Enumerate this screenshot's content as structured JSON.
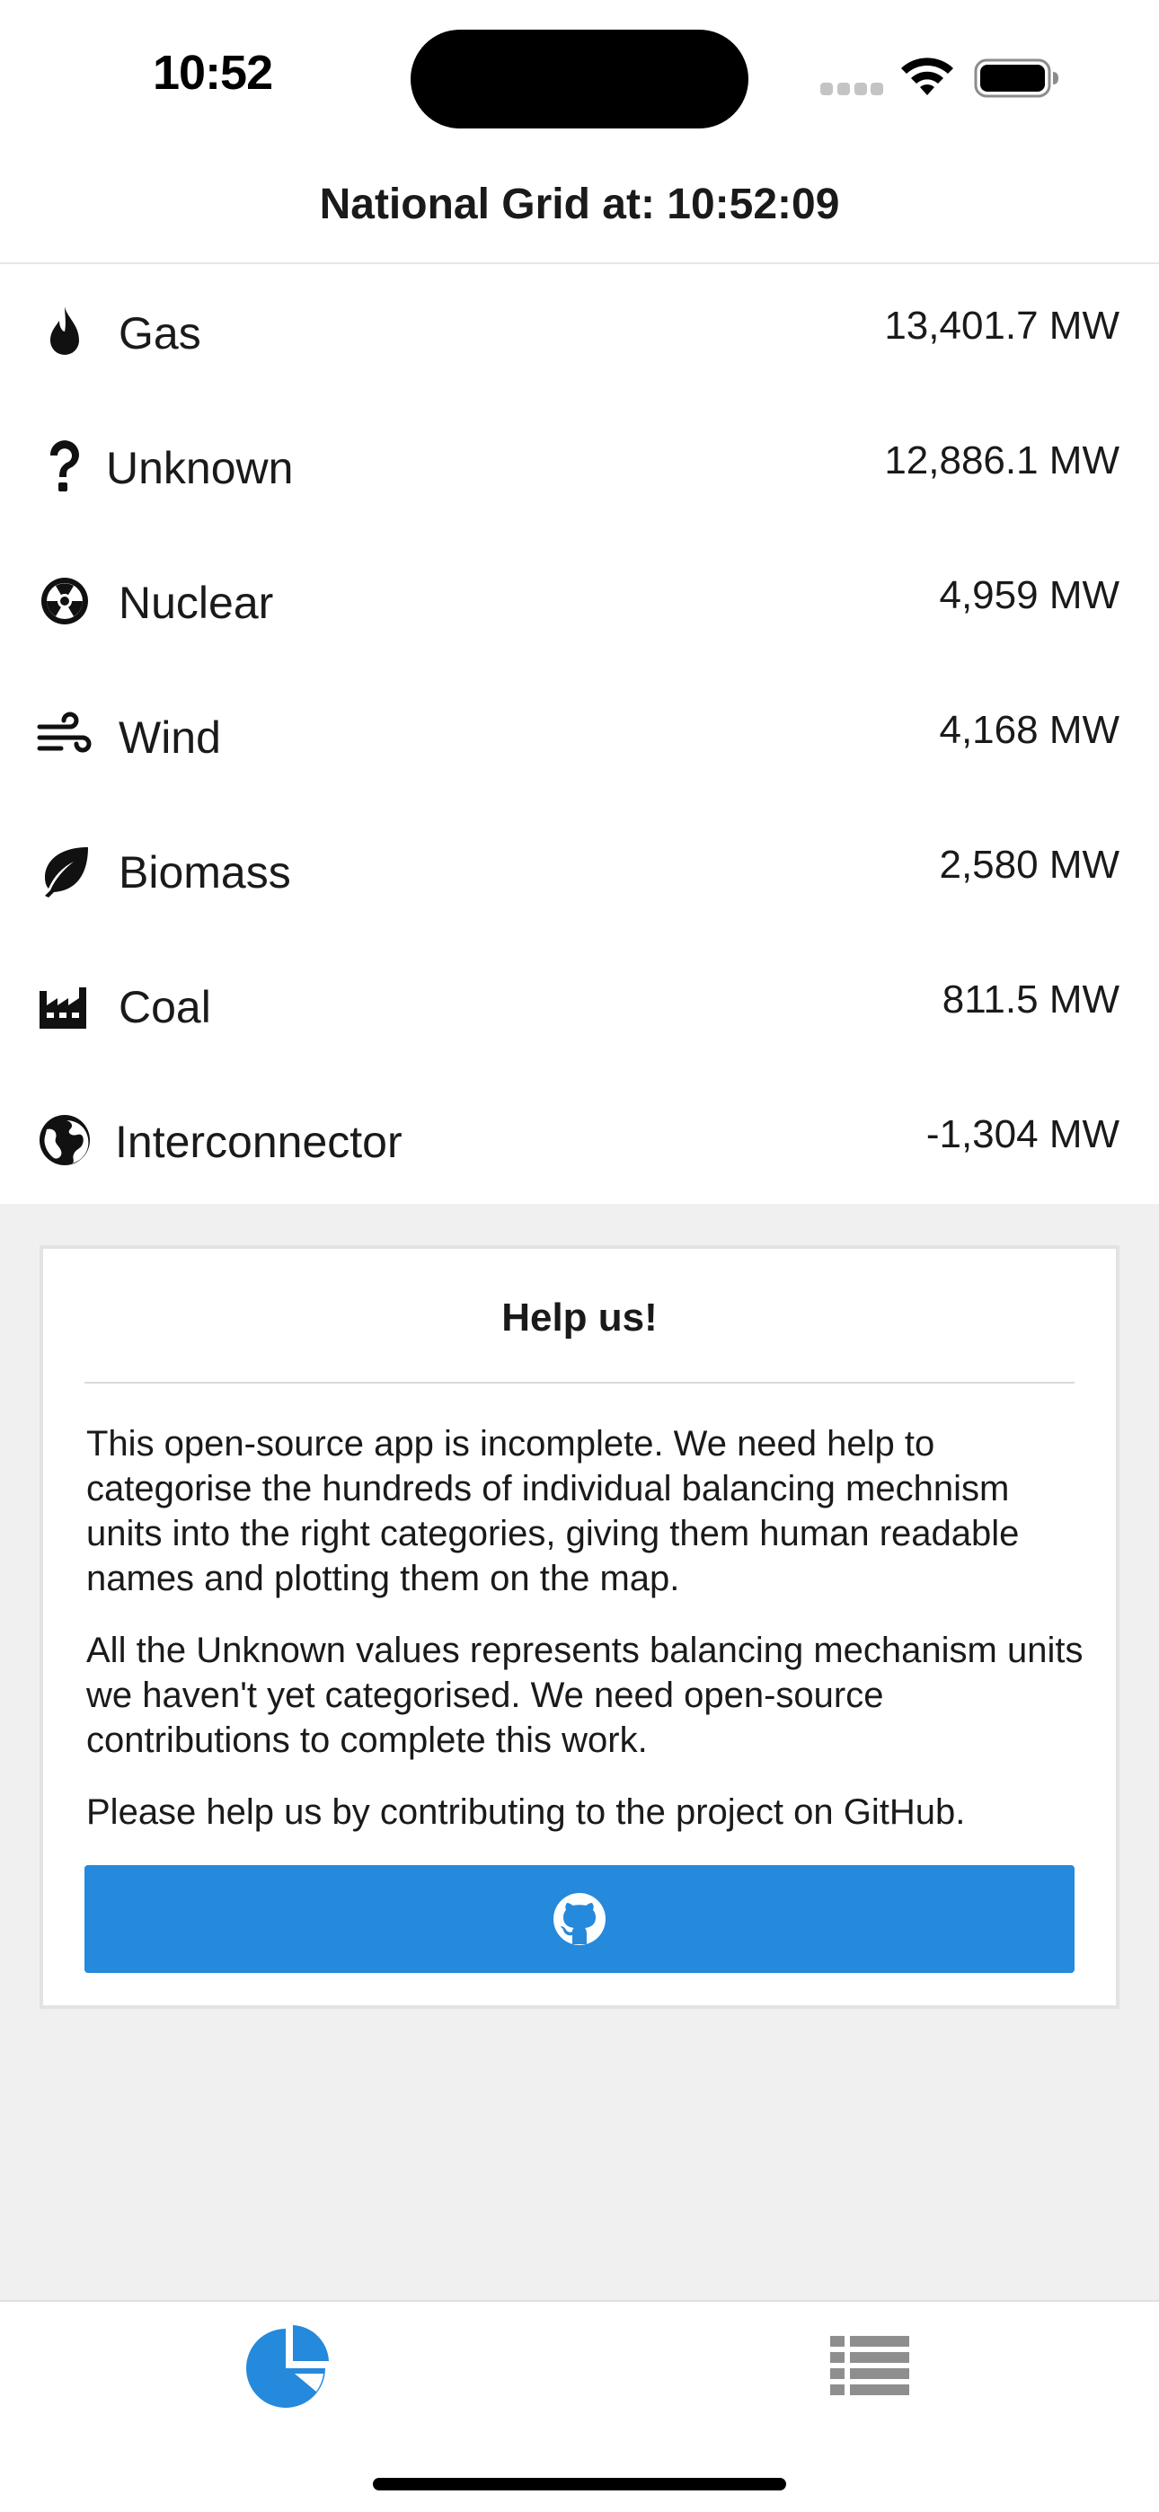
{
  "status_bar": {
    "time": "10:52"
  },
  "header": {
    "title": "National Grid at: 10:52:09"
  },
  "fuel_rows": [
    {
      "icon": "flame-icon",
      "label": "Gas",
      "value": "13,401.7 MW"
    },
    {
      "icon": "question-mark-icon",
      "label": "Unknown",
      "value": "12,886.1 MW"
    },
    {
      "icon": "radiation-icon",
      "label": "Nuclear",
      "value": "4,959 MW"
    },
    {
      "icon": "wind-icon",
      "label": "Wind",
      "value": "4,168 MW"
    },
    {
      "icon": "leaf-icon",
      "label": "Biomass",
      "value": "2,580 MW"
    },
    {
      "icon": "factory-icon",
      "label": "Coal",
      "value": "811.5 MW"
    },
    {
      "icon": "globe-icon",
      "label": "Interconnector",
      "value": "-1,304 MW"
    }
  ],
  "help_card": {
    "title": "Help us!",
    "paragraphs": [
      "This open-source app is incomplete. We need help to categorise the hundreds of individual balancing mechnism units into the right categories, giving them human readable names and plotting them on the map.",
      "All the Unknown values represents balancing mechanism units we haven't yet categorised. We need open-source contributions to complete this work.",
      "Please help us by contributing to the project on GitHub."
    ],
    "button_icon": "github-icon"
  },
  "tab_bar": {
    "tabs": [
      {
        "icon": "pie-chart-icon",
        "active": true
      },
      {
        "icon": "list-icon",
        "active": false
      }
    ],
    "active_color": "#2589dc",
    "inactive_color": "#8e8e8e"
  },
  "colors": {
    "accent": "#2589dc",
    "background_grey": "#f0f0f0"
  }
}
